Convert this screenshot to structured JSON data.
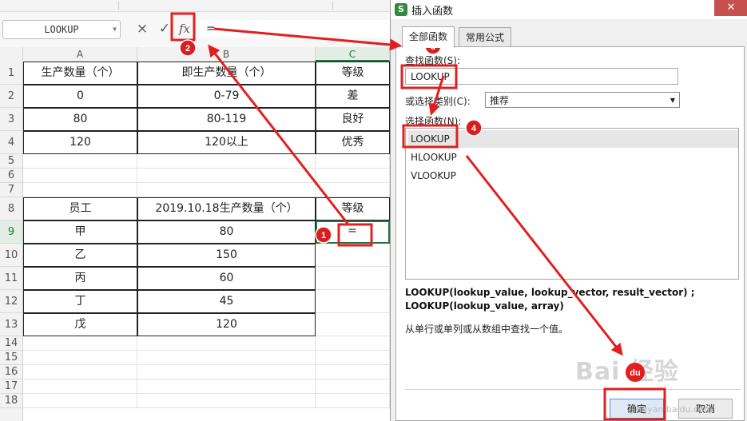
{
  "spreadsheet": {
    "name_box": "LOOKUP",
    "formula_icons": {
      "cancel": "×",
      "confirm": "✓",
      "fx": "fx"
    },
    "formula_input": "=",
    "columns": [
      "A",
      "B",
      "C"
    ],
    "rows": [
      "1",
      "2",
      "3",
      "4",
      "5",
      "6",
      "7",
      "8",
      "9",
      "10",
      "11",
      "12",
      "13",
      "14",
      "15",
      "16",
      "17",
      "18"
    ],
    "table1": {
      "headers": [
        "生产数量（个）",
        "即生产数量（个）",
        "等级"
      ],
      "rows": [
        [
          "0",
          "0-79",
          "差"
        ],
        [
          "80",
          "80-119",
          "良好"
        ],
        [
          "120",
          "120以上",
          "优秀"
        ]
      ]
    },
    "table2": {
      "headers": [
        "员工",
        "2019.10.18生产数量（个）",
        "等级"
      ],
      "rows": [
        [
          "甲",
          "80",
          "="
        ],
        [
          "乙",
          "150",
          ""
        ],
        [
          "丙",
          "60",
          ""
        ],
        [
          "丁",
          "45",
          ""
        ],
        [
          "戊",
          "120",
          ""
        ]
      ]
    }
  },
  "dialog": {
    "title": "插入函数",
    "app_icon": "S",
    "close": "✕",
    "tabs": [
      "全部函数",
      "常用公式"
    ],
    "search_label": "查找函数(S):",
    "search_value": "LOOKUP",
    "category_label": "或选择类别(C):",
    "category_value": "推荐",
    "list_label": "选择函数(N):",
    "functions": [
      "LOOKUP",
      "HLOOKUP",
      "VLOOKUP"
    ],
    "selected_function": "LOOKUP",
    "signature_line1": "LOOKUP(lookup_value, lookup_vector, result_vector) ;",
    "signature_line2": "LOOKUP(lookup_value, array)",
    "description": "从单行或单列或从数组中查找一个值。",
    "ok_label": "确定",
    "cancel_label": "取消"
  },
  "watermark": {
    "text": "Bai 经验",
    "url": "jingyan.baidu.com",
    "du": "du"
  },
  "annotations": {
    "color": "#e02020",
    "badges": [
      "1",
      "2",
      "3",
      "4"
    ]
  }
}
